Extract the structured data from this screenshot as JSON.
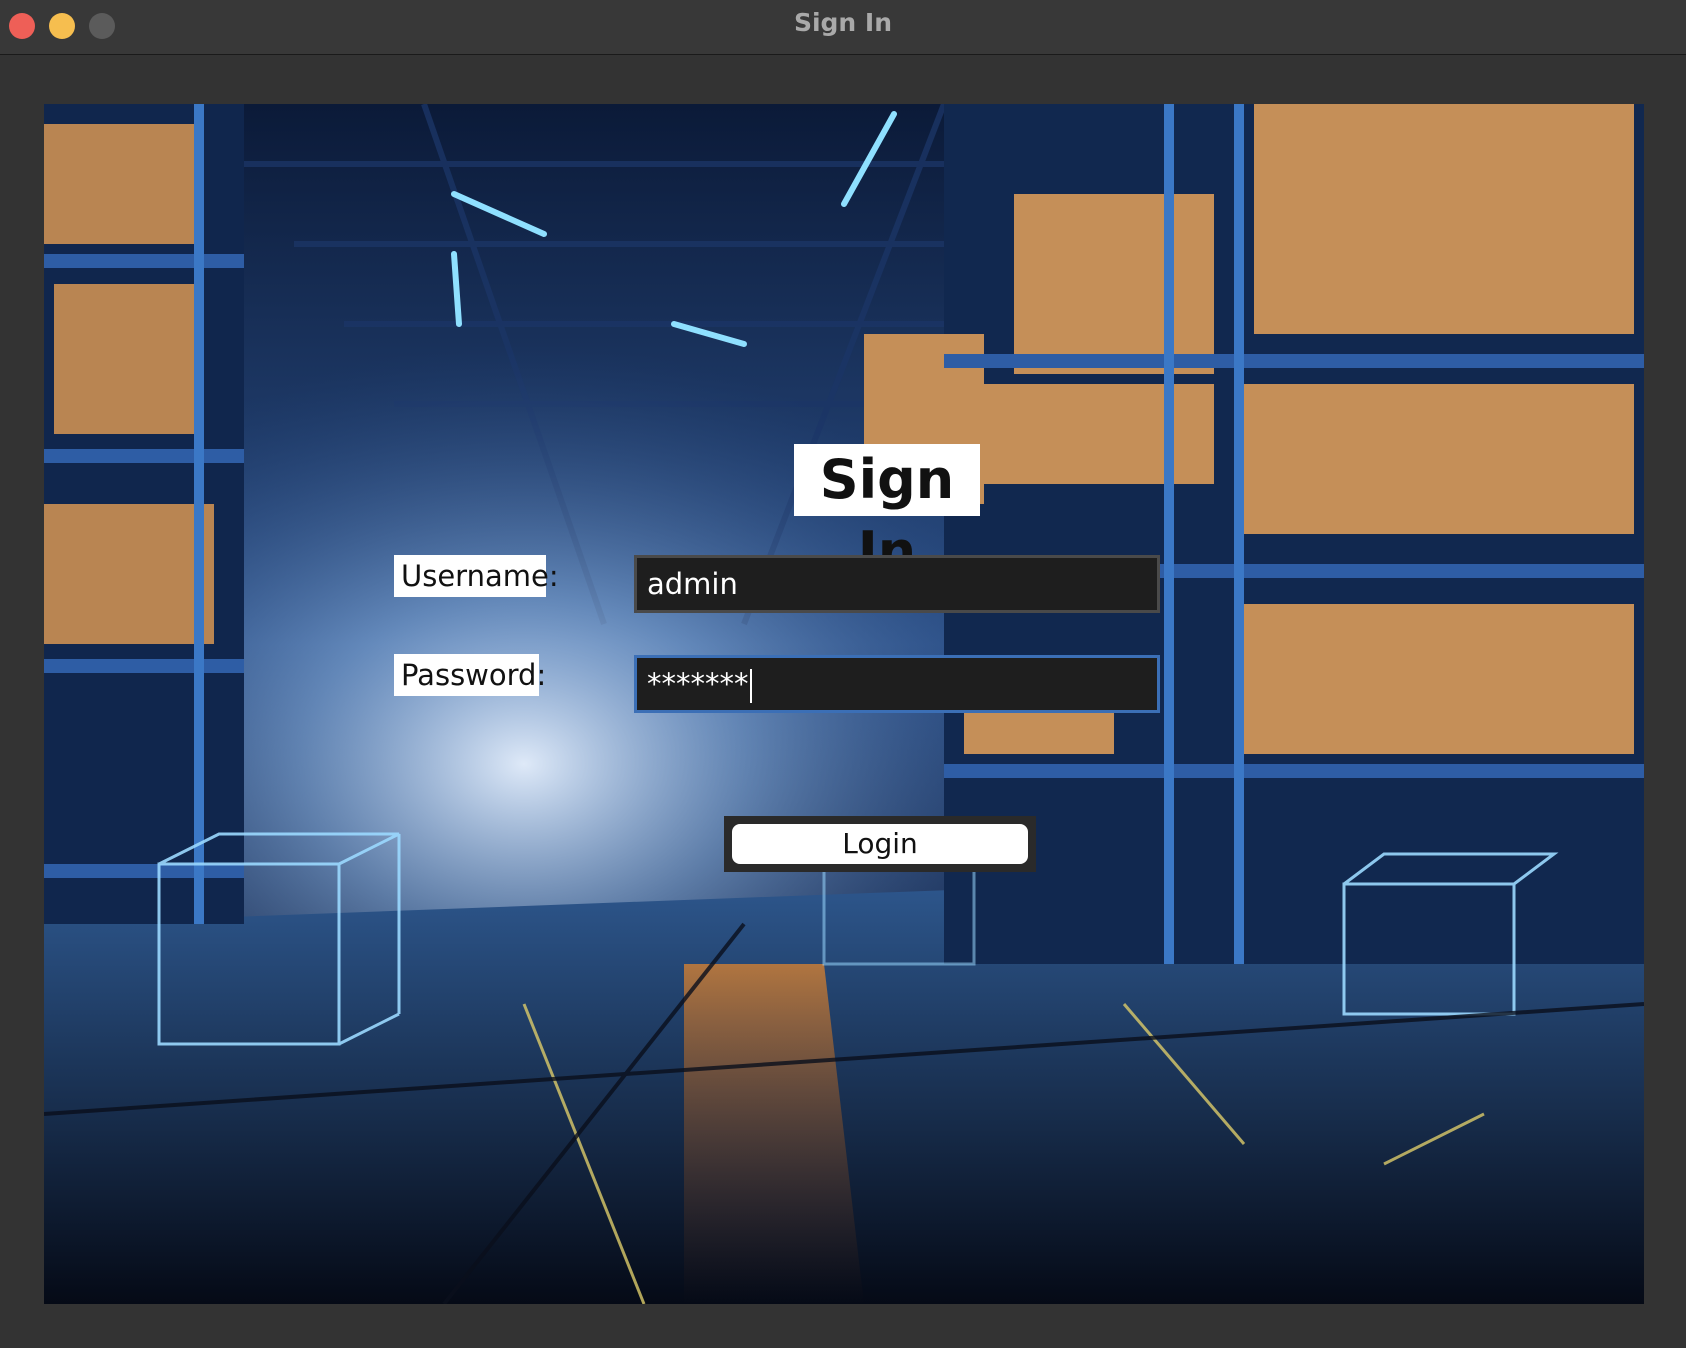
{
  "window": {
    "title": "Sign In"
  },
  "form": {
    "heading": "Sign In",
    "username_label": "Username:",
    "username_value": "admin",
    "password_label": "Password:",
    "password_value": "*******",
    "login_label": "Login"
  },
  "background": {
    "description_icon": "warehouse-background-image"
  },
  "colors": {
    "close": "#ee5f57",
    "minimize": "#f6be4f",
    "maximize": "#5b5b5b",
    "focus_ring": "#3b6fb6"
  }
}
